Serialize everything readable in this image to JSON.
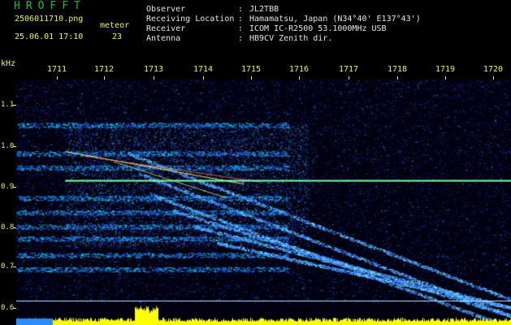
{
  "header": {
    "app_title": "HROFFT",
    "filename": "2506011710.png",
    "datetime": "25.06.01 17:10",
    "count_label": "meteor",
    "count_value": "23",
    "fields": [
      {
        "label": "Observer",
        "value": "JL2TBB"
      },
      {
        "label": "Receiving Location",
        "value": "Hamamatsu, Japan (N34°40' E137°43')"
      },
      {
        "label": "Receiver",
        "value": "ICOM IC-R2500 53.1000MHz USB"
      },
      {
        "label": "Antenna",
        "value": "HB9CV Zenith dir."
      }
    ],
    "separator": ":"
  },
  "axes": {
    "freq_unit": "kHz",
    "freq_ticks": [
      "1.1",
      "1.0",
      "0.9",
      "0.8",
      "0.7",
      "0.6"
    ],
    "time_ticks": [
      "1711",
      "1712",
      "1713",
      "1714",
      "1715",
      "1716",
      "1717",
      "1718",
      "1719",
      "1720"
    ]
  },
  "spectrogram": {
    "carrier_freq_khz": 0.915,
    "background_color": "#000010",
    "noise_color": "#1e4bff",
    "carrier_color": "#7fff9f",
    "signal_bar_color": "#ffff00",
    "reference_line_color": "#bfe8ff"
  }
}
